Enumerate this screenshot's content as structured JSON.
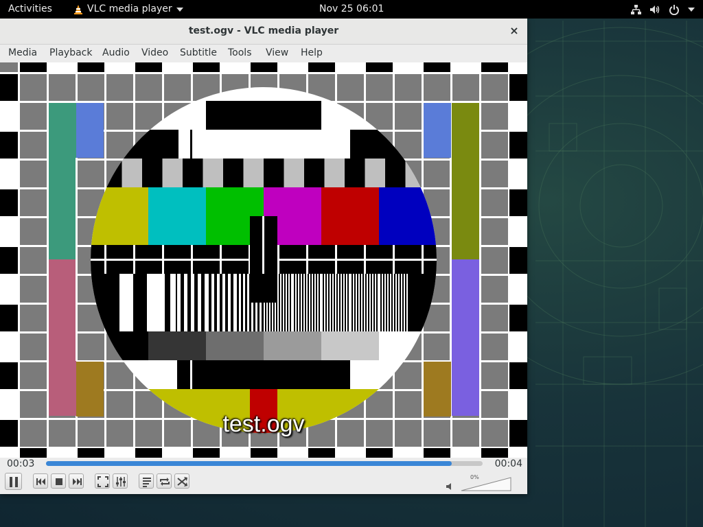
{
  "topbar": {
    "activities": "Activities",
    "app_name": "VLC media player",
    "clock": "Nov 25  06:01",
    "icons": [
      "network-icon",
      "volume-icon",
      "power-icon",
      "chevron-down-icon"
    ]
  },
  "window": {
    "title": "test.ogv - VLC media player",
    "close_glyph": "×"
  },
  "menu": [
    {
      "label": "Media",
      "accel": "M"
    },
    {
      "label": "Playback",
      "accel": "l"
    },
    {
      "label": "Audio",
      "accel": "A"
    },
    {
      "label": "Video",
      "accel": "V"
    },
    {
      "label": "Subtitle",
      "accel": "t"
    },
    {
      "label": "Tools",
      "accel": "s"
    },
    {
      "label": "View",
      "accel": "i"
    },
    {
      "label": "Help",
      "accel": "H"
    }
  ],
  "video": {
    "subtitle": "test.ogv"
  },
  "controls": {
    "elapsed": "00:03",
    "total": "00:04",
    "progress": 0.93,
    "volume_percent": "0%",
    "buttons": [
      "pause-icon",
      "previous-icon",
      "stop-icon",
      "next-icon",
      "fullscreen-icon",
      "extended-settings-icon",
      "playlist-icon",
      "loop-icon",
      "shuffle-icon"
    ]
  },
  "colors": {
    "seek_fill": "#3a86d6",
    "bar_yellow": "#bfbf00",
    "bar_cyan": "#00bfbf",
    "bar_green": "#00bf00",
    "bar_magenta": "#bf00bf",
    "bar_red": "#bf0000",
    "bar_blue": "#0000bf"
  }
}
